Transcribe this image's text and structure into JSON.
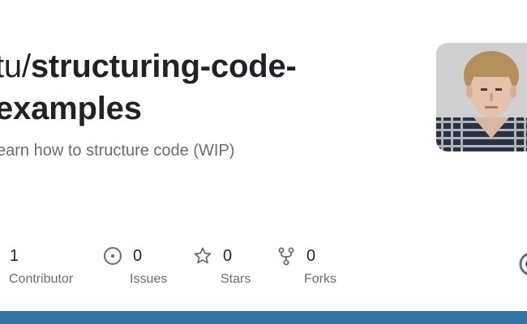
{
  "repo": {
    "owner_fragment": "tu",
    "separator": "/",
    "name": "structuring-code-examples",
    "description_visible": "earn how to structure code (WIP)"
  },
  "stats": [
    {
      "key": "contributors",
      "value": "1",
      "label": "Contributor",
      "icon": "people-icon"
    },
    {
      "key": "issues",
      "value": "0",
      "label": "Issues",
      "icon": "issue-opened-icon"
    },
    {
      "key": "stars",
      "value": "0",
      "label": "Stars",
      "icon": "star-icon"
    },
    {
      "key": "forks",
      "value": "0",
      "label": "Forks",
      "icon": "repo-forked-icon"
    }
  ],
  "colors": {
    "text_primary": "#1f2328",
    "text_muted": "#656d76",
    "language_bar": "#3572a5",
    "icon": "#656d76"
  },
  "icons": {
    "avatar": "owner-avatar",
    "edge": "github-logo-icon"
  }
}
